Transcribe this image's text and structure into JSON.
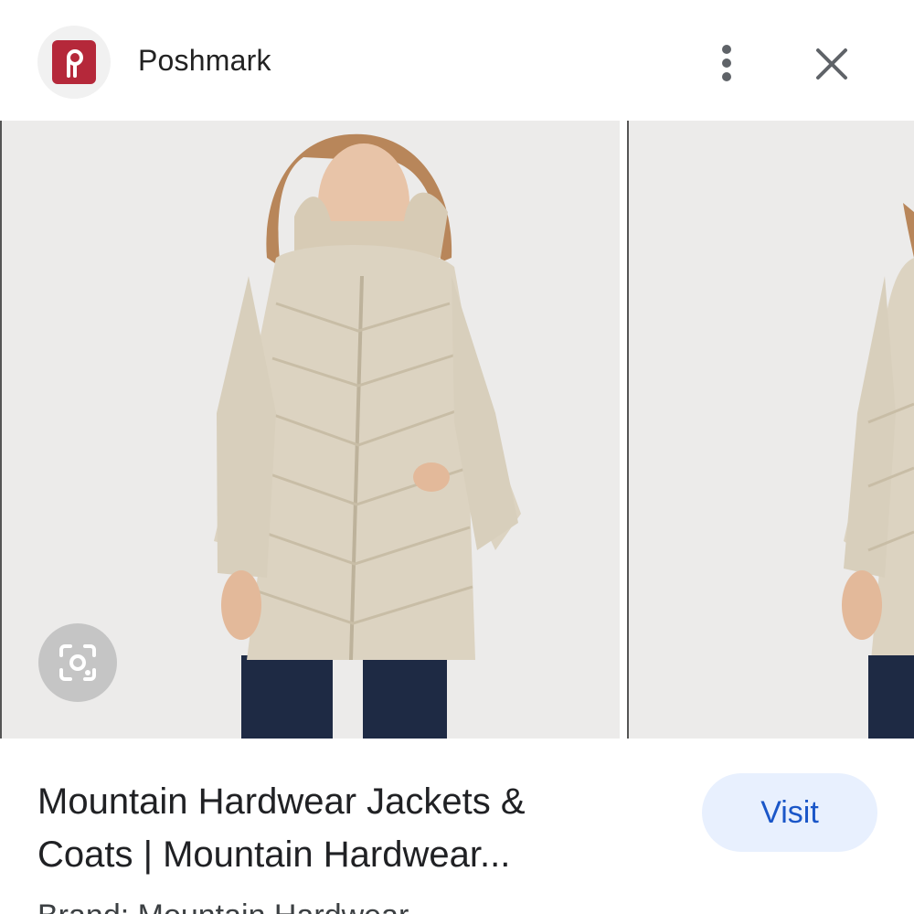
{
  "header": {
    "site_name": "Poshmark",
    "logo_icon": "poshmark-logo-icon",
    "brand_color": "#b5283a",
    "more_icon": "more-vert-icon",
    "close_icon": "close-icon"
  },
  "images": {
    "lens_icon": "google-lens-icon"
  },
  "result": {
    "title_line1": "Mountain Hardwear Jackets &",
    "title_line2": "Coats | Mountain Hardwear...",
    "visit_label": "Visit",
    "visit_color": "#1a56c8",
    "brand_text": "Brand: Mountain Hardwear"
  }
}
